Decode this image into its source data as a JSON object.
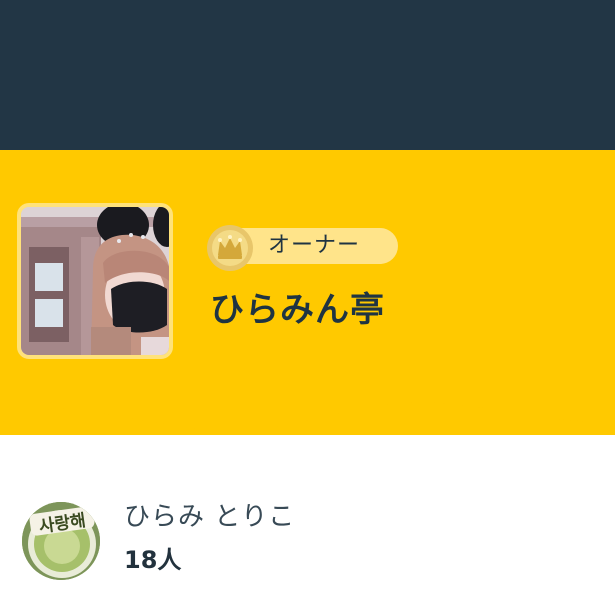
{
  "header": {
    "background_color": "#223645"
  },
  "hero": {
    "background_color": "#ffc900",
    "owner_photo_icon": "profile-photo",
    "role_badge": {
      "icon": "crown-medal-icon",
      "label": "オーナー"
    },
    "title": "ひらみん亭"
  },
  "member": {
    "avatar_icon": "latte-art-photo",
    "avatar_text": "사랑해",
    "name": "ひらみ とりこ",
    "count": "18人"
  }
}
